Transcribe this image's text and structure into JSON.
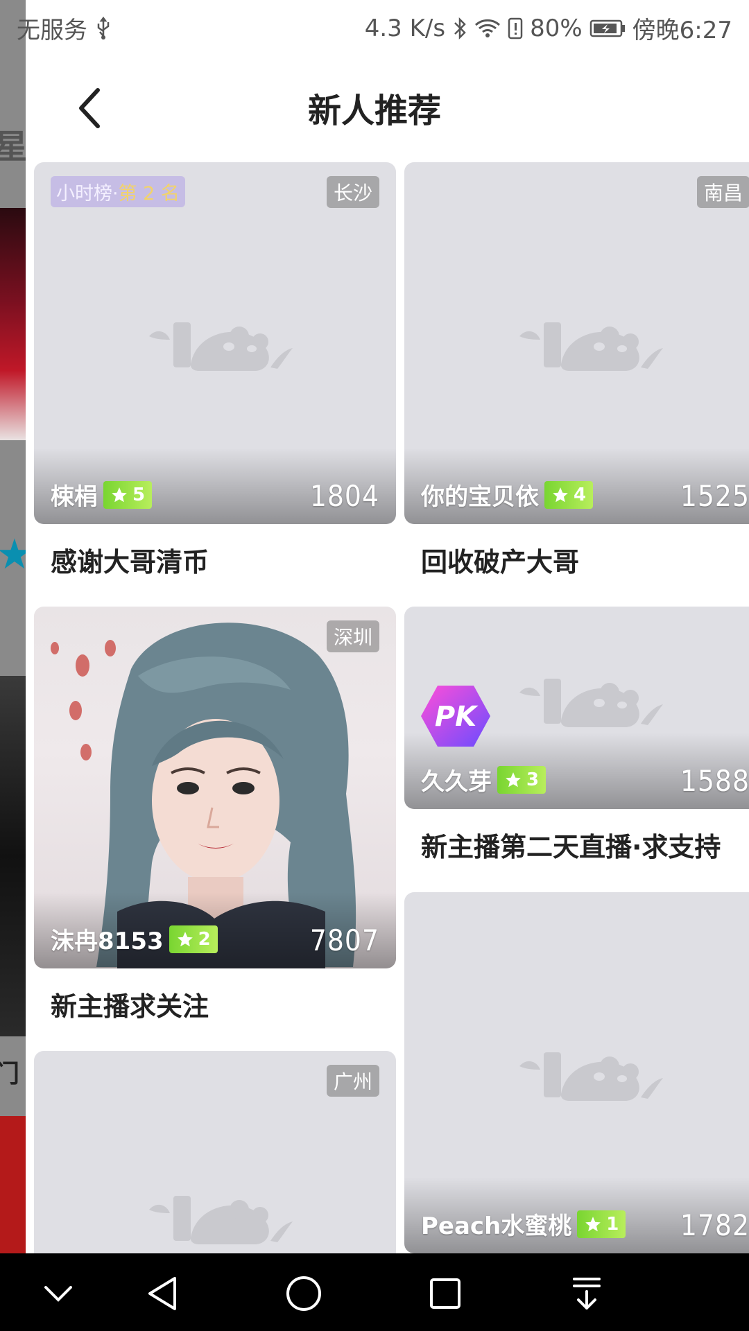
{
  "status_bar": {
    "carrier": "无服务",
    "net_speed": "4.3 K/s",
    "battery": "80%",
    "time": "傍晚6:27"
  },
  "header": {
    "title": "新人推荐"
  },
  "cards": [
    {
      "rank_label": "小时榜·",
      "rank_value": "第 2 名",
      "city": "长沙",
      "anchor_name": "梀梋",
      "level": "5",
      "viewers": "1804",
      "caption": "感谢大哥清币"
    },
    {
      "city": "南昌",
      "anchor_name": "你的宝贝依",
      "level": "4",
      "viewers": "1525",
      "caption": "回收破产大哥"
    },
    {
      "city": "深圳",
      "anchor_name": "沫冉8153",
      "level": "2",
      "viewers": "7807",
      "caption": "新主播求关注"
    },
    {
      "badge": "PK",
      "anchor_name": "久久芽",
      "level": "3",
      "viewers": "1588",
      "caption": "新主播第二天直播·求支持"
    },
    {
      "city": "广州"
    },
    {
      "anchor_name": "Peach水蜜桃",
      "level": "1",
      "viewers": "1782"
    }
  ],
  "colors": {
    "level_badge": "#8fdc3c",
    "card_placeholder": "#dfdfe4",
    "pk_gradient_start": "#ff4fd8",
    "pk_gradient_end": "#6a4cff"
  }
}
